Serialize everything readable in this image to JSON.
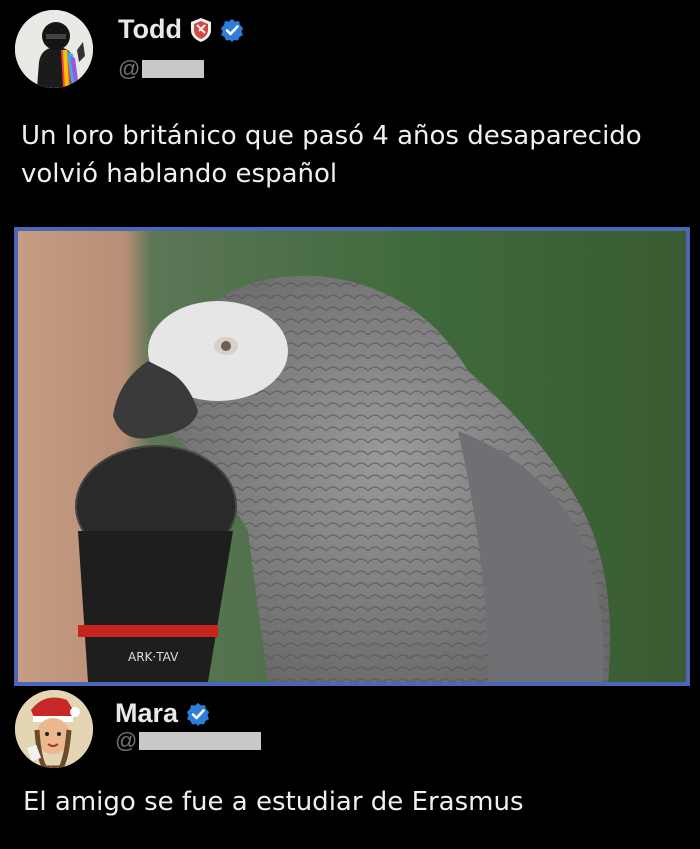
{
  "posts": [
    {
      "display_name": "Todd",
      "handle_prefix": "@",
      "text": "Un loro británico que pasó 4 años desaparecido\nvolvió hablando español",
      "media": {
        "microphone_brand": "ARK·TAV"
      }
    },
    {
      "display_name": "Mara",
      "handle_prefix": "@",
      "text": "El amigo se fue a estudiar de Erasmus"
    }
  ],
  "colors": {
    "background": "#000000",
    "verified": "#2f7ddb",
    "media_border": "#4b67b8",
    "shield": "#d04a44"
  },
  "icons": [
    "shield-badge-icon",
    "verified-badge-icon"
  ]
}
